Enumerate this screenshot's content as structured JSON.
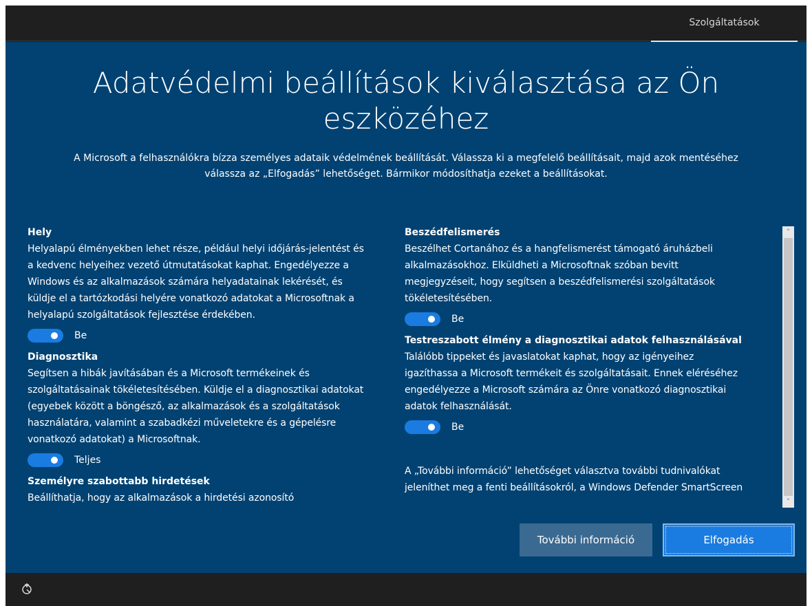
{
  "topbar": {
    "tab": "Szolgáltatások"
  },
  "header": {
    "title_line1": "Adatvédelmi beállítások kiválasztása az Ön",
    "title_line2": "eszközéhez",
    "subtitle_line1": "A Microsoft a felhasználókra bízza személyes adataik védelmének beállítását. Válassza ki a megfelelő beállításait, majd azok mentéséhez",
    "subtitle_line2": "válassza az „Elfogadás” lehetőséget. Bármikor módosíthatja ezeket a beállításokat."
  },
  "settings_left": [
    {
      "title": "Hely",
      "lines": [
        "Helyalapú élményekben lehet része, például helyi időjárás-jelentést és",
        "a kedvenc helyeihez vezető útmutatásokat kaphat. Engedélyezze a",
        "Windows és az alkalmazások számára helyadatainak lekérését, és",
        "küldje el a tartózkodási helyére vonatkozó adatokat a Microsoftnak a",
        "helyalapú szolgáltatások fejlesztése érdekében."
      ],
      "toggle": "Be"
    },
    {
      "title": "Diagnosztika",
      "lines": [
        "Segítsen a hibák javításában és a Microsoft termékeinek és",
        "szolgáltatásainak tökéletesítésében. Küldje el a diagnosztikai adatokat",
        "(egyebek között a böngésző, az alkalmazások és a szolgáltatások",
        "használatára, valamint a szabadkézi műveletekre és a gépelésre",
        "vonatkozó adatokat) a Microsoftnak."
      ],
      "toggle": "Teljes"
    },
    {
      "title": "Személyre szabottabb hirdetések",
      "lines": [
        "Beállíthatja, hogy az alkalmazások a hirdetési azonosító"
      ]
    }
  ],
  "settings_right": [
    {
      "title": "Beszédfelismerés",
      "lines": [
        "Beszélhet Cortanához és a hangfelismerést támogató áruházbeli",
        "alkalmazásokhoz. Elküldheti a Microsoftnak szóban bevitt",
        "megjegyzéseit, hogy segítsen a beszédfelismerési szolgáltatások",
        "tökéletesítésében."
      ],
      "toggle": "Be"
    },
    {
      "title": "Testreszabott élmény a diagnosztikai adatok felhasználásával",
      "lines": [
        "Találóbb tippeket és javaslatokat kaphat, hogy az igényeihez",
        "igazíthassa a Microsoft termékeit és szolgáltatásait. Ennek eléréséhez",
        "engedélyezze a Microsoft számára az Önre vonatkozó diagnosztikai",
        "adatok felhasználását."
      ],
      "toggle": "Be"
    }
  ],
  "info_lines": [
    "A „További információ” lehetőséget választva további tudnivalókat",
    "jeleníthet meg a fenti beállításokról, a Windows Defender SmartScreen"
  ],
  "scrollbar": {
    "up": "˄",
    "down": "˅"
  },
  "buttons": {
    "more": "További információ",
    "accept": "Elfogadás"
  },
  "icons": {
    "accessibility": "accessibility-icon",
    "scroll_up": "chevron-up-icon",
    "scroll_down": "chevron-down-icon"
  },
  "colors": {
    "panel": "#024272",
    "toggle_on": "#1a7ce0",
    "frame": "#1f1f1f"
  }
}
